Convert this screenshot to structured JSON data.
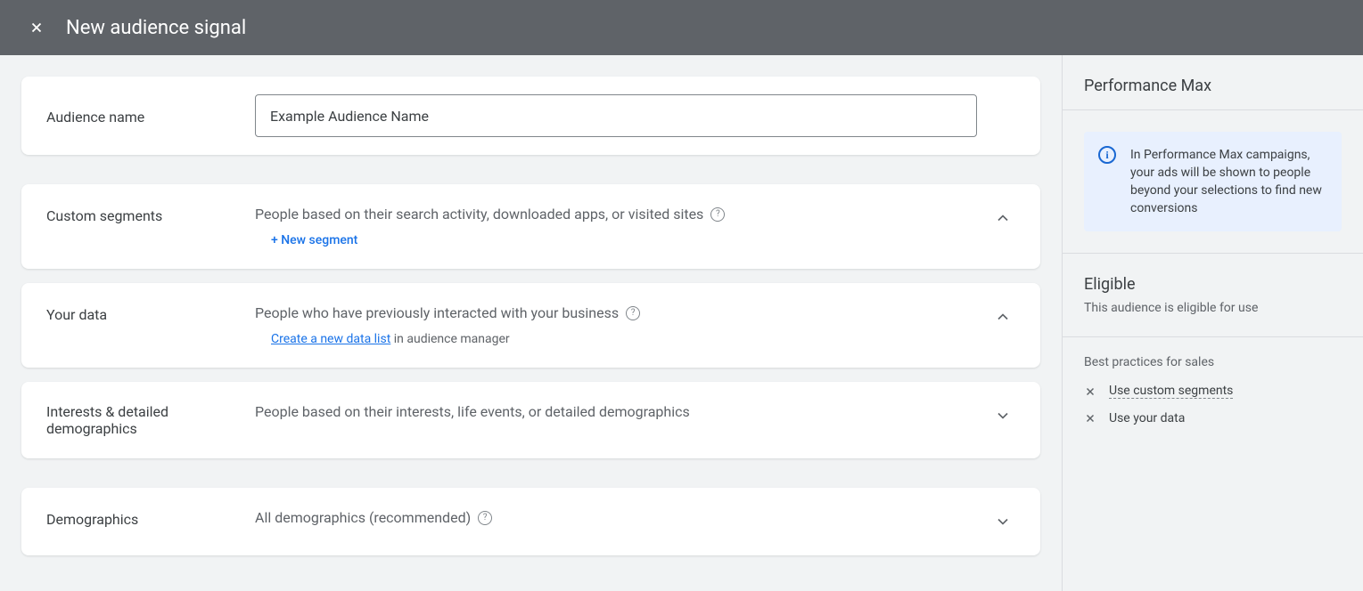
{
  "header": {
    "title": "New audience signal"
  },
  "main": {
    "audienceName": {
      "label": "Audience name",
      "value": "Example Audience Name"
    },
    "customSegments": {
      "label": "Custom segments",
      "description": "People based on their search activity, downloaded apps, or visited sites",
      "action": "+ New segment"
    },
    "yourData": {
      "label": "Your data",
      "description": "People who have previously interacted with your business",
      "link": "Create a new data list",
      "linkSuffix": " in audience manager"
    },
    "interests": {
      "label": "Interests & detailed demographics",
      "description": "People based on their interests, life events, or detailed demographics"
    },
    "demographics": {
      "label": "Demographics",
      "description": "All demographics (recommended)"
    }
  },
  "sidebar": {
    "pmax": {
      "title": "Performance Max",
      "info": "In Performance Max campaigns, your ads will be shown to people beyond your selections to find new conversions"
    },
    "eligible": {
      "title": "Eligible",
      "sub": "This audience is eligible for use"
    },
    "bestPractices": {
      "title": "Best practices for sales",
      "items": [
        {
          "label": "Use custom segments",
          "dashed": true
        },
        {
          "label": "Use your data",
          "dashed": false
        }
      ]
    }
  }
}
